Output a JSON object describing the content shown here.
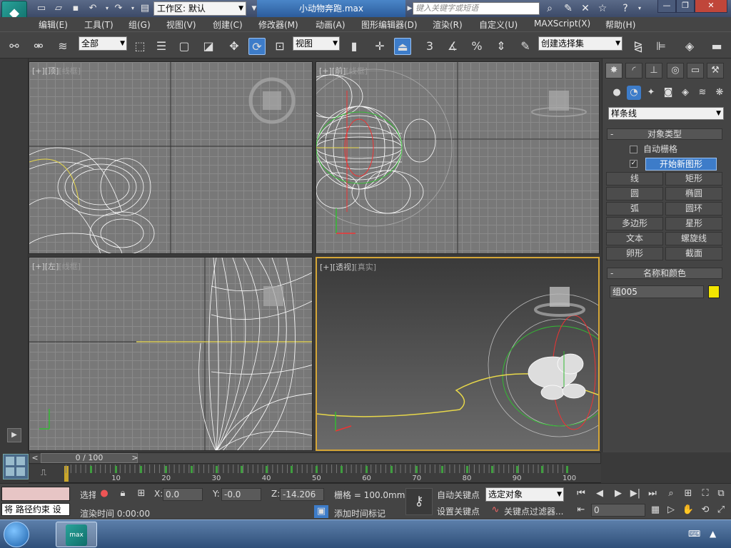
{
  "title_bar": {
    "workspace_label": "工作区: 默认",
    "file_title": "小动物奔跑.max",
    "search_placeholder": "键入关键字或短语"
  },
  "menu": [
    "编辑(E)",
    "工具(T)",
    "组(G)",
    "视图(V)",
    "创建(C)",
    "修改器(M)",
    "动画(A)",
    "图形编辑器(D)",
    "渲染(R)",
    "自定义(U)",
    "MAXScript(X)",
    "帮助(H)"
  ],
  "main_toolbar": {
    "selection_filter": "全部",
    "ref_coord": "视图",
    "named_selection": "创建选择集",
    "snap_label": "3"
  },
  "viewports": {
    "top": {
      "plus": "[+]",
      "name": "[顶]",
      "shading": "[线框]"
    },
    "front": {
      "plus": "[+]",
      "name": "[前]",
      "shading": "[线框]"
    },
    "left": {
      "plus": "[+]",
      "name": "[左]",
      "shading": "[线框]"
    },
    "persp": {
      "plus": "[+]",
      "name": "[透视]",
      "shading": "[真实]"
    }
  },
  "command_panel": {
    "category": "样条线",
    "object_type_title": "对象类型",
    "auto_grid": "自动栅格",
    "start_new_shape": "开始新图形",
    "shapes": [
      "线",
      "矩形",
      "圆",
      "椭圆",
      "弧",
      "圆环",
      "多边形",
      "星形",
      "文本",
      "螺旋线",
      "卵形",
      "截面"
    ],
    "name_color_title": "名称和颜色",
    "object_name": "组005",
    "object_color": "#f2e500"
  },
  "timeline": {
    "frame_display": "0 / 100",
    "ticks": [
      "10",
      "20",
      "30",
      "40",
      "50",
      "60",
      "70",
      "80",
      "90",
      "100"
    ]
  },
  "status": {
    "maxscript_line": "将 路径约束 设",
    "selection_label": "选择",
    "x_value": "0.0",
    "y_value": "-0.0",
    "z_value": "-14.206",
    "grid": "栅格 = 100.0mm",
    "auto_key": "自动关键点",
    "set_key": "设置关键点",
    "key_mode": "选定对象",
    "key_filters": "关键点过滤器...",
    "render_time": "渲染时间  0:00:00",
    "add_time_tag": "添加时间标记",
    "current_frame": "0"
  }
}
